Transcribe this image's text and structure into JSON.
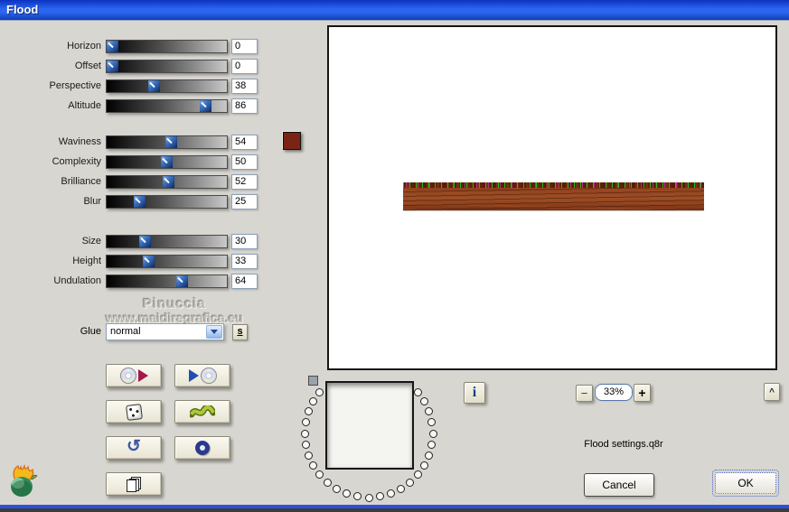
{
  "titlebar": {
    "title": "Flood"
  },
  "sliders": [
    {
      "label": "Horizon",
      "value": 0
    },
    {
      "label": "Offset",
      "value": 0
    },
    {
      "label": "Perspective",
      "value": 38
    },
    {
      "label": "Altitude",
      "value": 86
    },
    {
      "label": "Waviness",
      "value": 54
    },
    {
      "label": "Complexity",
      "value": 50
    },
    {
      "label": "Brilliance",
      "value": 52
    },
    {
      "label": "Blur",
      "value": 25
    },
    {
      "label": "Size",
      "value": 30
    },
    {
      "label": "Height",
      "value": 33
    },
    {
      "label": "Undulation",
      "value": 64
    }
  ],
  "color_swatch": {
    "color": "#7a2415"
  },
  "watermark": {
    "line1": "Pinuccia",
    "line2": "www.maidiregrafica.eu"
  },
  "glue": {
    "label": "Glue",
    "value": "normal",
    "shortcut_key": "s"
  },
  "preset_buttons": {
    "save_icons": [
      "cd-icon",
      "red-play-icon"
    ],
    "load_icons": [
      "blue-play-icon",
      "cd-icon"
    ],
    "random_icon": "dice-icon",
    "wave_icon": "green-wave-icon",
    "undo_icon": "undo-arrow-icon",
    "undo_glyph": "↺",
    "ring_icon": "ring-icon",
    "copy_icon": "copy-pages-icon"
  },
  "view_controls": {
    "info_label": "i",
    "zoom_out_label": "−",
    "zoom_level": "33%",
    "zoom_in_label": "+",
    "collapse_label": "^"
  },
  "footer": {
    "settings_filename": "Flood settings.q8r",
    "cancel_label": "Cancel",
    "ok_label": "OK"
  },
  "colors": {
    "titlebar_blue": "#2a66f0",
    "bottom_border_blue": "#2b50e0",
    "wood_base": "#9c4e26",
    "wood_dark": "#5e2408",
    "wood_fleck_green": "#22c018",
    "wood_fleck_magenta": "#c02898"
  }
}
